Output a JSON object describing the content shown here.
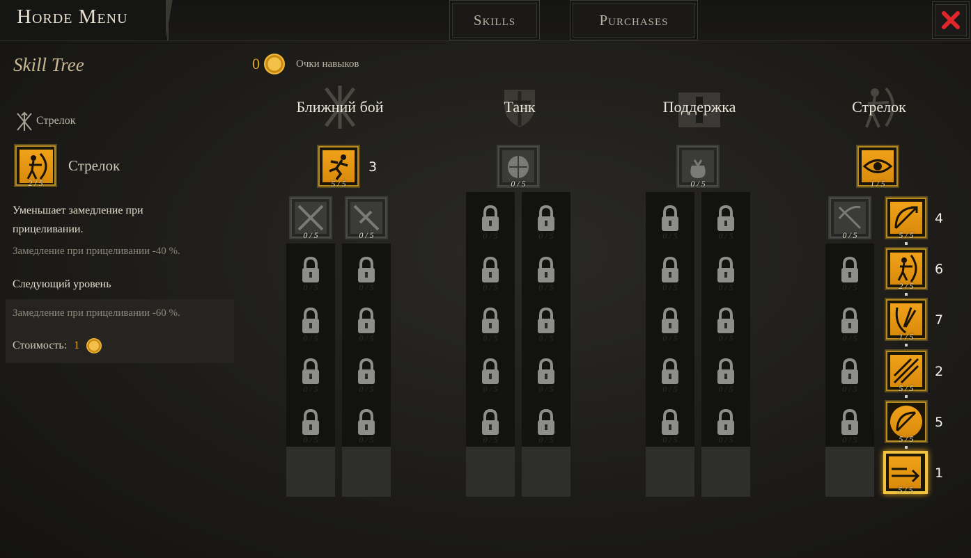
{
  "header": {
    "title": "Horde Menu",
    "tabs": [
      {
        "label": "Skills"
      },
      {
        "label": "Purchases"
      }
    ],
    "close_icon": "close-icon"
  },
  "left_panel": {
    "heading": "Skill Tree",
    "class_tag": "Стрелок",
    "selected": {
      "name": "Стрелок",
      "rank": "2 / 5"
    },
    "description": "Уменьшает замедление при прицеливании.",
    "effect": "Замедление при прицеливании -40 %.",
    "next_level_heading": "Следующий уровень",
    "next_effect": "Замедление при прицеливании -60 %.",
    "cost_label": "Стоимость:",
    "cost_value": "1"
  },
  "points": {
    "value": "0",
    "label": "Очки навыков"
  },
  "columns": [
    {
      "title": "Ближний бой",
      "root_rank": "5 / 5",
      "root_order": "3",
      "branch_ranks": [
        "0 / 5",
        "0 / 5"
      ]
    },
    {
      "title": "Танк",
      "root_rank": "0 / 5"
    },
    {
      "title": "Поддержка",
      "root_rank": "0 / 5"
    },
    {
      "title": "Стрелок",
      "root_rank": "1 / 5",
      "branch_left_rank": "0 / 5",
      "chain": [
        {
          "rank": "5 / 5",
          "order": "4"
        },
        {
          "rank": "2 / 5",
          "order": "6"
        },
        {
          "rank": "1 / 5",
          "order": "7"
        },
        {
          "rank": "5 / 5",
          "order": "2"
        },
        {
          "rank": "5 / 5",
          "order": "5"
        },
        {
          "rank": "5 / 5",
          "order": "1"
        }
      ]
    }
  ],
  "locked_label": "0 / 5",
  "colors": {
    "gold": "#e8a21c",
    "close_red": "#e0262b",
    "text": "#e2dccd"
  }
}
